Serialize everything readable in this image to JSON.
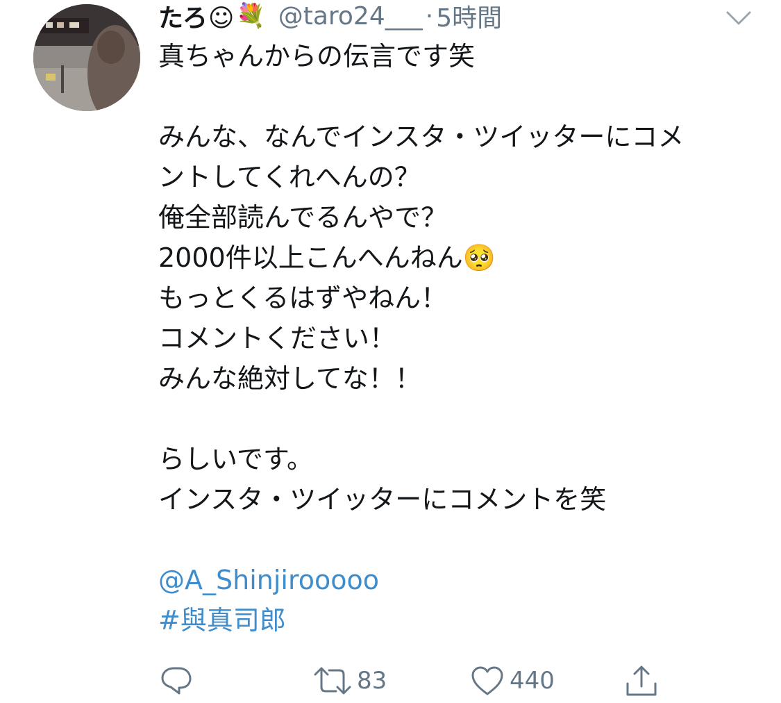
{
  "tweet": {
    "author": {
      "display_name": "たろ☺",
      "name_emoji": "💐",
      "handle": "@taro24___",
      "separator": "·",
      "time": "5時間"
    },
    "menu_icon": "chevron-down-icon",
    "lines": [
      "真ちゃんからの伝言です笑",
      "",
      "みんな、なんでインスタ・ツイッターにコメ",
      "ントしてくれへんの？",
      "俺全部読んでるんやで？",
      "2000件以上こんへんねん🥺",
      "もっとくるはずやねん！",
      "コメントください！",
      "みんな絶対してな！！",
      "",
      "らしいです。",
      "インスタ・ツイッターにコメントを笑",
      ""
    ],
    "mention": "@A_Shinjirooooo",
    "hashtag": "#與真司郎",
    "actions": {
      "reply": {
        "icon": "reply-icon",
        "count": ""
      },
      "retweet": {
        "icon": "retweet-icon",
        "count": "83"
      },
      "like": {
        "icon": "heart-icon",
        "count": "440"
      },
      "share": {
        "icon": "share-icon",
        "count": ""
      }
    },
    "colors": {
      "text": "#14171a",
      "secondary": "#657786",
      "link": "#3f8dcc"
    }
  }
}
